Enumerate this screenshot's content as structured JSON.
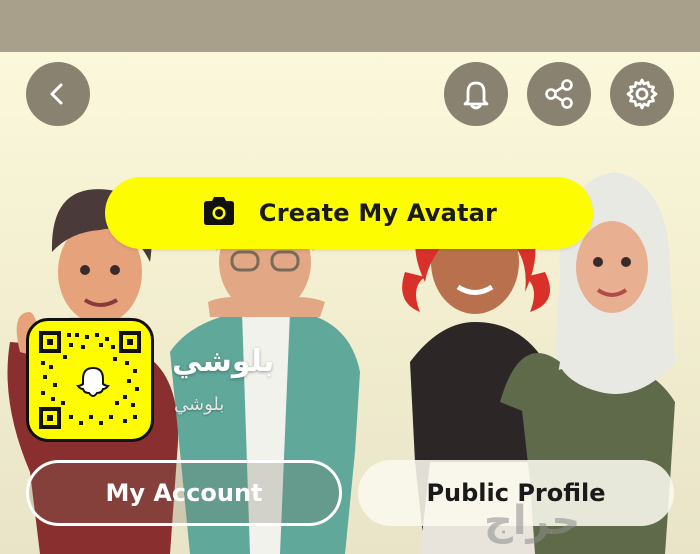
{
  "header": {
    "back_icon": "chevron-left-icon"
  },
  "actions": {
    "notifications_icon": "bell-icon",
    "share_icon": "share-icon",
    "settings_icon": "gear-icon"
  },
  "create_avatar": {
    "label": "Create My Avatar",
    "icon": "camera-icon"
  },
  "profile": {
    "display_name": "بلوشي",
    "username": "بلوشي"
  },
  "buttons": {
    "my_account": "My Account",
    "public_profile": "Public Profile"
  },
  "watermark": "حراج",
  "colors": {
    "snap_yellow": "#fffc00",
    "round_button": "#8a8270"
  }
}
